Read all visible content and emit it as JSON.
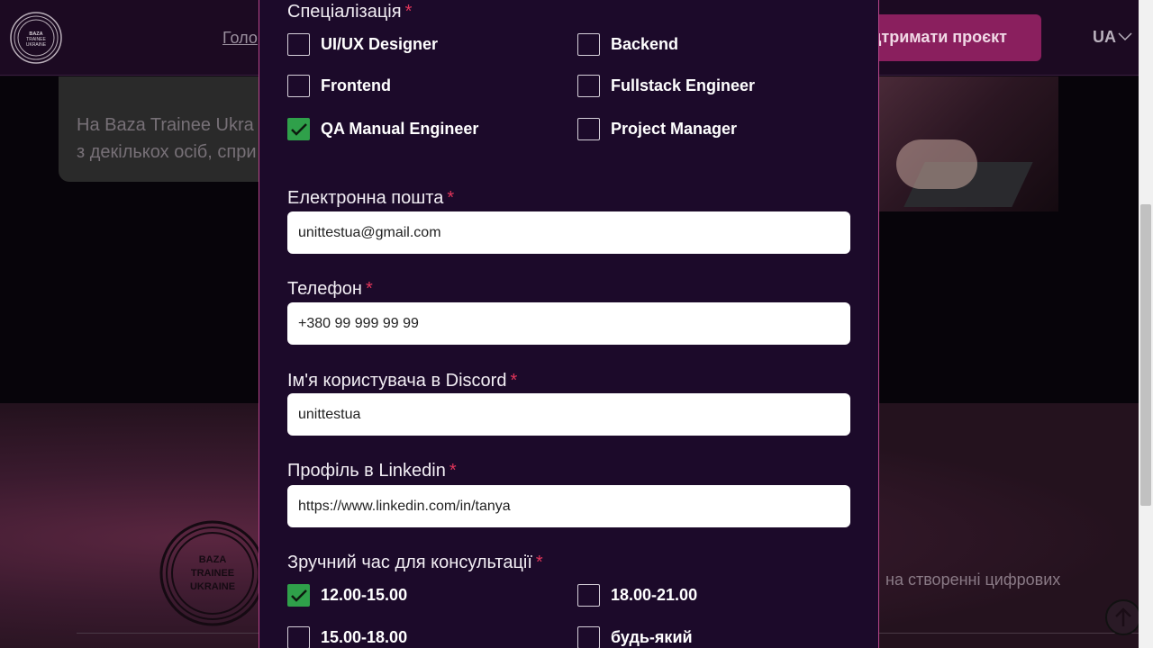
{
  "header": {
    "logo_text": "BAZA TRAINEE UKRAINE",
    "nav_home": "Голо",
    "support_button": "ідтримати проєкт",
    "language": "UA"
  },
  "hero": {
    "info_line1": "На Baza Trainee Ukra",
    "info_line2": "з декількох осіб, спри"
  },
  "footer": {
    "logo_text": "BAZA TRAINEE UKRAINE",
    "text": "на створенні цифрових"
  },
  "form": {
    "specialization": {
      "label": "Спеціалізація",
      "required_mark": "*",
      "options": [
        {
          "label": "UI/UX Designer",
          "checked": false
        },
        {
          "label": "Backend",
          "checked": false
        },
        {
          "label": "Frontend",
          "checked": false
        },
        {
          "label": "Fullstack Engineer",
          "checked": false
        },
        {
          "label": "QA Manual Engineer",
          "checked": true
        },
        {
          "label": "Project Manager",
          "checked": false
        }
      ]
    },
    "email": {
      "label": "Електронна пошта",
      "required_mark": "*",
      "value": "unittestua@gmail.com"
    },
    "phone": {
      "label": "Телефон",
      "required_mark": "*",
      "value": "+380 99 999 99 99"
    },
    "discord": {
      "label": "Ім'я користувача в Discord",
      "required_mark": "*",
      "value": "unittestua"
    },
    "linkedin": {
      "label": "Профіль в Linkedin",
      "required_mark": "*",
      "value": "https://www.linkedin.com/in/tanya"
    },
    "consult_time": {
      "label": "Зручний час для консультації",
      "required_mark": "*",
      "options": [
        {
          "label": "12.00-15.00",
          "checked": true
        },
        {
          "label": "18.00-21.00",
          "checked": false
        },
        {
          "label": "15.00-18.00",
          "checked": false
        },
        {
          "label": "будь-який",
          "checked": false
        }
      ]
    }
  },
  "colors": {
    "modal_bg": "#1c0a2a",
    "accent_border": "#b8458a",
    "required": "#e0355a",
    "checkbox_checked": "#2fa04a"
  }
}
